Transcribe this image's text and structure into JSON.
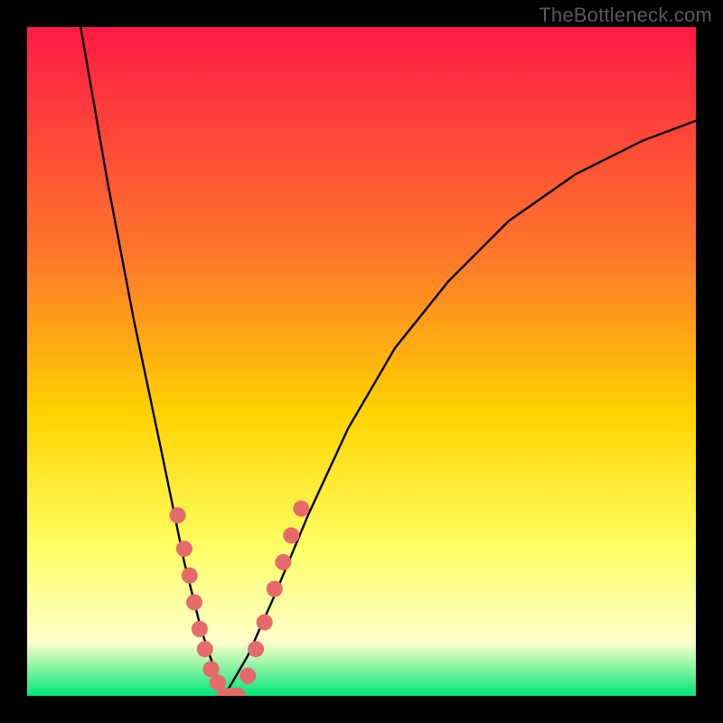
{
  "watermark": "TheBottleneck.com",
  "colors": {
    "frame": "#000000",
    "gradient_top": "#ff1a45",
    "gradient_mid1": "#ff7a2a",
    "gradient_mid2": "#ffd400",
    "gradient_mid3": "#ffff66",
    "gradient_low": "#ffffcc",
    "gradient_bottom": "#00e676",
    "curve": "#000000",
    "markers": "#e66a6a"
  },
  "chart_data": {
    "type": "line",
    "title": "",
    "xlabel": "",
    "ylabel": "",
    "xlim": [
      0,
      1
    ],
    "ylim": [
      0,
      1
    ],
    "grid": false,
    "series": [
      {
        "name": "left-branch",
        "x": [
          0.08,
          0.12,
          0.16,
          0.2,
          0.235,
          0.26,
          0.28,
          0.295
        ],
        "y": [
          1.0,
          0.77,
          0.56,
          0.37,
          0.2,
          0.1,
          0.04,
          0.0
        ]
      },
      {
        "name": "right-branch",
        "x": [
          0.295,
          0.33,
          0.37,
          0.42,
          0.48,
          0.55,
          0.63,
          0.72,
          0.82,
          0.92,
          1.0
        ],
        "y": [
          0.0,
          0.06,
          0.15,
          0.27,
          0.4,
          0.52,
          0.62,
          0.71,
          0.78,
          0.83,
          0.86
        ]
      }
    ],
    "markers": [
      {
        "x": 0.225,
        "y": 0.27
      },
      {
        "x": 0.235,
        "y": 0.22
      },
      {
        "x": 0.243,
        "y": 0.18
      },
      {
        "x": 0.25,
        "y": 0.14
      },
      {
        "x": 0.258,
        "y": 0.1
      },
      {
        "x": 0.266,
        "y": 0.07
      },
      {
        "x": 0.275,
        "y": 0.04
      },
      {
        "x": 0.285,
        "y": 0.02
      },
      {
        "x": 0.295,
        "y": 0.0
      },
      {
        "x": 0.305,
        "y": 0.0
      },
      {
        "x": 0.315,
        "y": 0.0
      },
      {
        "x": 0.33,
        "y": 0.03
      },
      {
        "x": 0.342,
        "y": 0.07
      },
      {
        "x": 0.355,
        "y": 0.11
      },
      {
        "x": 0.37,
        "y": 0.16
      },
      {
        "x": 0.383,
        "y": 0.2
      },
      {
        "x": 0.395,
        "y": 0.24
      },
      {
        "x": 0.41,
        "y": 0.28
      }
    ],
    "annotations": []
  }
}
